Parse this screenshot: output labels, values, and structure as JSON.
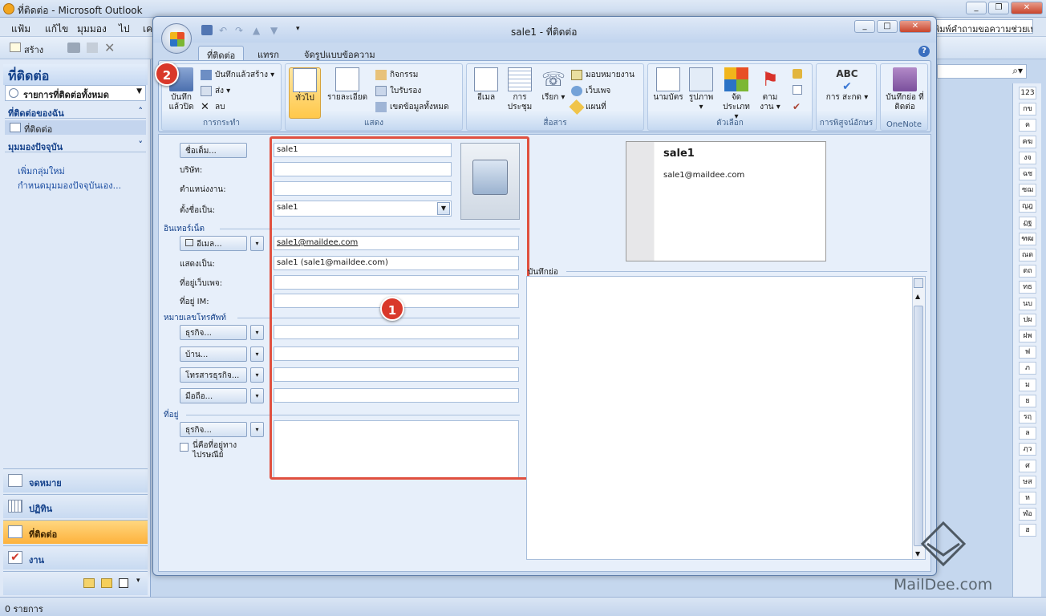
{
  "main_window": {
    "title": "ที่ติดต่อ - Microsoft Outlook",
    "menu": [
      "แฟ้ม",
      "แก้ไข",
      "มุมมอง",
      "ไป",
      "เค"
    ],
    "new_button": "สร้าง",
    "help_box": "พิมพ์คำถามขอความช่วยเหลือ"
  },
  "nav": {
    "header": "ที่ติดต่อ",
    "dropdown": "รายการที่ติดต่อทั้งหมด",
    "my_contacts": "ที่ติดต่อของฉัน",
    "contacts_item": "ที่ติดต่อ",
    "current_view": "มุมมองปัจจุบัน",
    "links": [
      "เพิ่มกลุ่มใหม่",
      "กำหนดมุมมองปัจจุบันเอง..."
    ],
    "buttons": [
      "จดหมาย",
      "ปฏิทิน",
      "ที่ติดต่อ",
      "งาน"
    ]
  },
  "status": "0 รายการ",
  "letter_index": [
    "123",
    "กข",
    "ค",
    "ฅฆ",
    "งจ",
    "ฉช",
    "ซฌ",
    "ญฎ",
    "ฏฐ",
    "ฑฒ",
    "ณด",
    "ตถ",
    "ทธ",
    "นบ",
    "ปผ",
    "ฝพ",
    "ฟ",
    "ภ",
    "ม",
    "ย",
    "รฤ",
    "ล",
    "ฦว",
    "ศ",
    "ษส",
    "ห",
    "ฬอ",
    "ฮ"
  ],
  "dialog": {
    "title": "sale1 - ที่ติดต่อ",
    "tabs": [
      "ที่ติดต่อ",
      "แทรก",
      "จัดรูปแบบข้อความ"
    ],
    "ribbon": {
      "actions": {
        "save_close": "บันทึก แล้วปิด",
        "save_new": "บันทึกแล้วสร้าง",
        "send": "ส่ง",
        "delete": "ลบ",
        "label": "การกระทำ"
      },
      "show": {
        "general": "ทั่วไป",
        "details": "รายละเอียด",
        "activities": "กิจกรรม",
        "certificates": "ใบรับรอง",
        "all_fields": "เขตข้อมูลทั้งหมด",
        "label": "แสดง"
      },
      "communicate": {
        "email": "อีเมล",
        "meeting": "การ ประชุม",
        "call": "เรียก",
        "assign_task": "มอบหมายงาน",
        "web_page": "เว็บเพจ",
        "map": "แผนที่",
        "label": "สื่อสาร"
      },
      "options": {
        "business_card": "นามบัตร",
        "picture": "รูปภาพ",
        "categorize": "จัด ประเภท",
        "follow_up": "ตาม งาน",
        "label": "ตัวเลือก"
      },
      "proofing": {
        "abc": "ABC",
        "spelling": "การ สะกด",
        "label": "การพิสูจน์อักษร"
      },
      "onenote": {
        "notes": "บันทึกย่อ ที่ติดต่อ",
        "label": "OneNote"
      }
    },
    "form": {
      "full_name_btn": "ชื่อเต็ม...",
      "full_name": "sale1",
      "company_label": "บริษัท:",
      "company": "",
      "job_title_label": "ตำแหน่งงาน:",
      "job_title": "",
      "file_as_label": "ตั้งชื่อเป็น:",
      "file_as": "sale1",
      "internet_section": "อินเทอร์เน็ต",
      "email_btn": "อีเมล...",
      "email": "sale1@maildee.com",
      "display_as_label": "แสดงเป็น:",
      "display_as": "sale1 (sale1@maildee.com)",
      "web_label": "ที่อยู่เว็บเพจ:",
      "web": "",
      "im_label": "ที่อยู่ IM:",
      "im": "",
      "phone_section": "หมายเลขโทรศัพท์",
      "phones": [
        "ธุรกิจ...",
        "บ้าน...",
        "โทรสารธุรกิจ...",
        "มือถือ..."
      ],
      "address_section": "ที่อยู่",
      "address_btn": "ธุรกิจ...",
      "mailing_checkbox": "นี่คือที่อยู่ทาง ไปรษณีย์",
      "notes_label": "บันทึกย่อ"
    },
    "card": {
      "name": "sale1",
      "email": "sale1@maildee.com"
    },
    "callouts": [
      "1",
      "2"
    ]
  },
  "watermark": "MailDee.com",
  "colors": {
    "highlight": "#e0503f",
    "active_nav": "#fdb23c",
    "link": "#1a4ca1"
  }
}
